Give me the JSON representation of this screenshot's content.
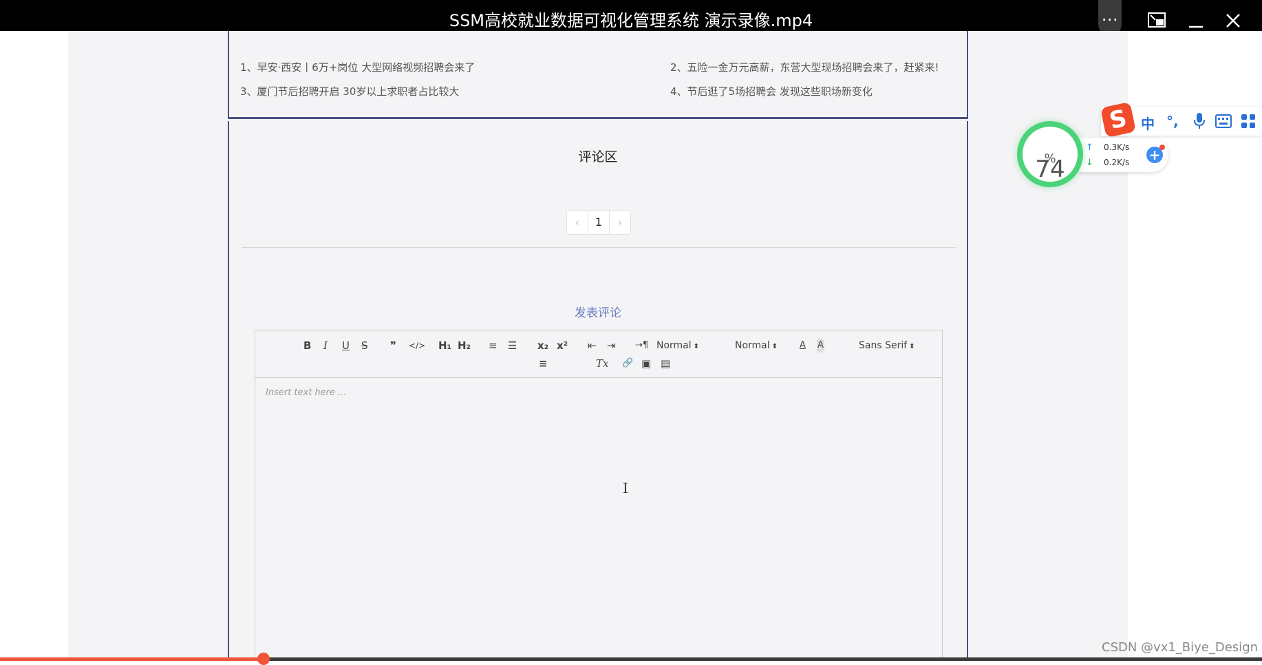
{
  "player": {
    "title": "SSM高校就业数据可视化管理系统 演示录像.mp4",
    "more_icon": "⋯",
    "pip_icon": "⧉",
    "min_icon": "—",
    "close_icon": "✕",
    "progress_fraction": 0.209
  },
  "news": {
    "items": [
      {
        "label": "1、早安·西安丨6万+岗位 大型网络视频招聘会来了"
      },
      {
        "label": "2、五险一金万元高薪，东营大型现场招聘会来了，赶紧来!"
      },
      {
        "label": "3、厦门节后招聘开启 30岁以上求职者占比较大"
      },
      {
        "label": "4、节后逛了5场招聘会 发现这些职场新变化"
      }
    ]
  },
  "comments": {
    "title": "评论区",
    "pager": {
      "prev": "‹",
      "page": "1",
      "next": "›"
    },
    "post_title": "发表评论"
  },
  "editor": {
    "placeholder": "Insert text here ...",
    "header_picker": "Normal",
    "size_picker": "Normal",
    "font_picker": "Sans Serif",
    "buttons": {
      "bold": "B",
      "italic": "I",
      "underline": "U",
      "strike": "S",
      "blockquote": "❞",
      "code": "</>",
      "h1": "H₁",
      "h2": "H₂",
      "ordered": "≡",
      "bullet": "☰",
      "sub": "x₂",
      "sup": "x²",
      "outdent": "⇤",
      "indent": "⇥",
      "direction": "⇢¶",
      "color": "A",
      "background": "A",
      "align": "≡",
      "clean": "Tx",
      "link": "🔗",
      "image": "▣",
      "video": "▤"
    }
  },
  "netmon": {
    "percent": "74",
    "unit": "%",
    "up": "0.3K/s",
    "down": "0.2K/s"
  },
  "ime": {
    "lang": "中",
    "punct": "°,"
  },
  "watermark": "CSDN @vx1_Biye_Design"
}
